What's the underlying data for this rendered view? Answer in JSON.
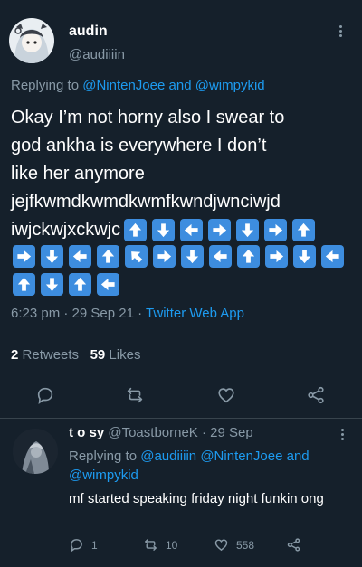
{
  "main_tweet": {
    "display_name": "audin",
    "handle": "@audiiiin",
    "replying_prefix": "Replying to",
    "reply_to_1": "@NintenJoee",
    "reply_and": "and",
    "reply_to_2": "@wimpykid",
    "text_lines": [
      "Okay I’m not horny also I swear to",
      "god ankha is everywhere I don’t",
      "like her anymore",
      "jejfkwmdkwmdkwmfkwndjwnciwjd",
      "iwjckwjxckwjc"
    ],
    "arrows_line1": [
      "up",
      "down",
      "left",
      "right",
      "down",
      "right",
      "up"
    ],
    "arrows_line2": [
      "right",
      "down",
      "left",
      "up",
      "upleft",
      "right",
      "down",
      "left",
      "up",
      "right",
      "down",
      "left"
    ],
    "arrows_line3": [
      "up",
      "down",
      "up",
      "left"
    ],
    "time": "6:23 pm",
    "sep": "·",
    "date": "29 Sep 21",
    "source": "Twitter Web App",
    "retweets_count": "2",
    "retweets_label": "Retweets",
    "likes_count": "59",
    "likes_label": "Likes",
    "action_icons": [
      "reply-icon",
      "retweet-icon",
      "like-icon",
      "share-icon"
    ]
  },
  "reply_tweet": {
    "display_name": "t o sy",
    "handle": "@ToastborneK",
    "sep": "·",
    "date": "29 Sep",
    "replying_prefix": "Replying to",
    "reply_to_1": "@audiiiin",
    "reply_to_2": "@NintenJoee",
    "reply_and": "and",
    "reply_to_3": "@wimpykid",
    "text": "mf started speaking friday night funkin ong",
    "reply_count": "1",
    "retweet_count": "10",
    "like_count": "558"
  },
  "colors": {
    "background": "#15202b",
    "link": "#1d9bf0",
    "muted": "#8899a6",
    "arrow_key": "#3d8ddf",
    "divider": "#38444d"
  }
}
